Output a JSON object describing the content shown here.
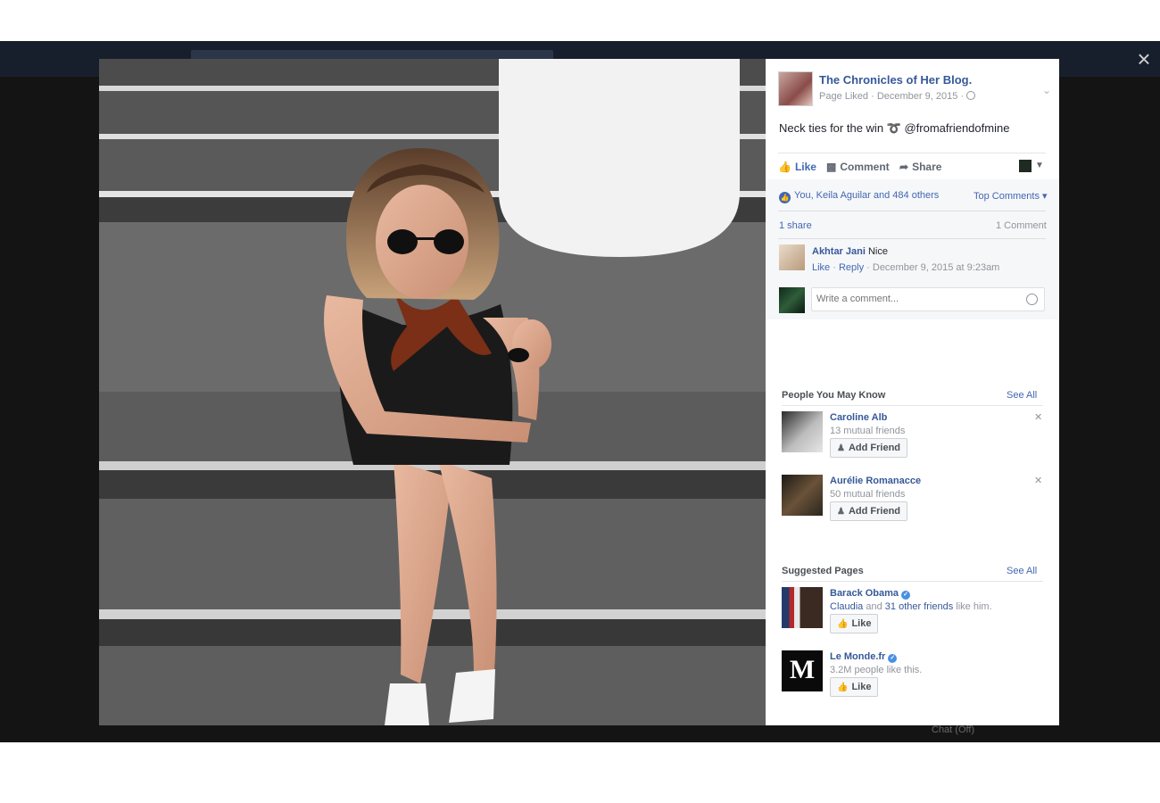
{
  "backdrop": {
    "chat_label": "Chat (Off)"
  },
  "viewer": {
    "close_icon": "×"
  },
  "post": {
    "page_name": "The Chronicles of Her Blog.",
    "meta": "Page Liked · December 9, 2015 ·",
    "text": "Neck ties for the win ➰ @fromafriendofmine",
    "actions": {
      "like": "Like",
      "comment": "Comment",
      "share": "Share"
    },
    "likes_summary": "You, Keila Aguilar and 484 others",
    "top_comments": "Top Comments ▾",
    "share_count": "1 share",
    "comment_count": "1 Comment",
    "comment": {
      "author": "Akhtar Jani",
      "text": "Nice",
      "like": "Like",
      "reply": "Reply",
      "timestamp": "December 9, 2015 at 9:23am"
    },
    "comment_placeholder": "Write a comment..."
  },
  "people_you_may_know": {
    "title": "People You May Know",
    "see_all": "See All",
    "people": [
      {
        "name": "Caroline Alb",
        "mutual": "13 mutual friends",
        "button": "Add Friend"
      },
      {
        "name": "Aurélie Romanacce",
        "mutual": "50 mutual friends",
        "button": "Add Friend"
      }
    ]
  },
  "suggested_pages": {
    "title": "Suggested Pages",
    "see_all": "See All",
    "pages": [
      {
        "name": "Barack Obama",
        "friend": "Claudia",
        "and": "and",
        "others": "31 other friends",
        "suffix": "like him.",
        "button": "Like"
      },
      {
        "name": "Le Monde.fr",
        "sub": "3.2M people like this.",
        "button": "Like"
      }
    ]
  },
  "colors": {
    "link": "#365899",
    "accent": "#4267b2",
    "backdrop": "#141414"
  }
}
